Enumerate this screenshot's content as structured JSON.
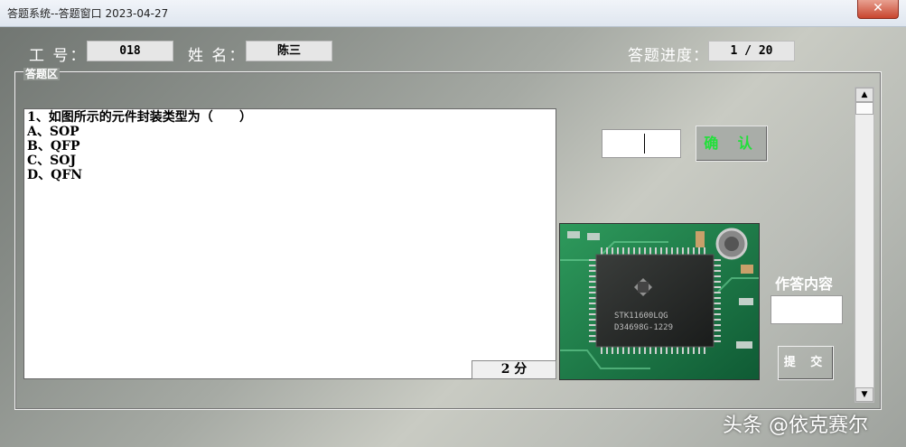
{
  "window": {
    "title": "答题系统--答题窗口 2023-04-27",
    "close_label": "✕"
  },
  "header": {
    "employee_label": "工 号：",
    "employee_value": "018",
    "name_label": "姓 名：",
    "name_value": "陈三",
    "progress_label": "答题进度：",
    "progress_value": "1 / 20"
  },
  "answer_area": {
    "title": "答题区",
    "question_lines": [
      "1、如图所示的元件封装类型为（      ）",
      "A、SOP",
      "B、QFP",
      "C、SOJ",
      "D、QFN"
    ],
    "score": "2 分",
    "answer_input_value": "",
    "confirm_label": "确 认",
    "response_label": "作答内容",
    "response_value": "",
    "submit_label": "提 交",
    "image": {
      "chip_text_1": "STK11600LQG",
      "chip_text_2": "D34698G-1229"
    }
  },
  "watermark": "头条 @依克赛尔",
  "colors": {
    "confirm_text": "#22e03a",
    "close_button": "#c8452f"
  },
  "icons": {
    "scroll_up": "▲",
    "scroll_down": "▼"
  }
}
